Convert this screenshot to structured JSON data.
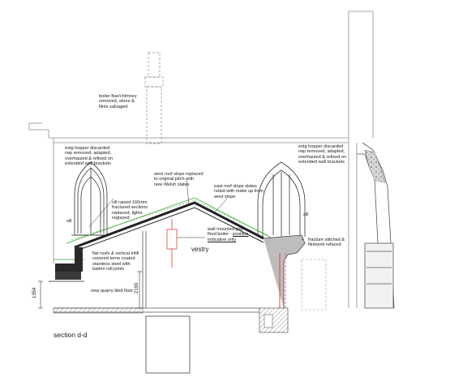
{
  "annotations": {
    "boiler_flue": "boiler flue/chimney\nremoved, stone &\nflints salvaged",
    "hopper_left": "extg hopper discarded\nrwp removed, adapted,\noverhauled & refixed on\nextended wall brackets",
    "hopper_right": "extg hopper discarded\nrwp removed, adapted,\noverhauled & refixed on\nextended wall brackets",
    "west_roof": "west roof slope replaced\nto original pitch with\nnew Welsh slates",
    "east_roof": "east roof slope slates\nrelaid with make up from\nwest slope",
    "cill": "cill raised 160mm\nfractured sections\nreplaced, lights\nreglazed",
    "sill_left": "sill",
    "sill_right": "sill",
    "boiler_line1": "wall mounted gas\nfired boiler - ",
    "boiler_underlined": "position\nindicative only",
    "vestry": "vestry",
    "fracture": "fracture stitched &\nflintwork refaced",
    "flat_roofs": "flat roofs & vertical infill\ncovered terne coated\nstainless steel with\nbatten roll joints",
    "quarry_floor": "new quarry tiled floor",
    "section_title": "section d-d"
  },
  "dimensions": {
    "left_height": "1354",
    "door_height": "2190"
  },
  "colors": {
    "line": "#222222",
    "grey_line": "#9a9a9a",
    "new_work_green": "#3aa23a",
    "boiler_red": "#e0453a",
    "hatch_grey": "#bdbdbd",
    "dark_fill": "#2a2a2a"
  }
}
